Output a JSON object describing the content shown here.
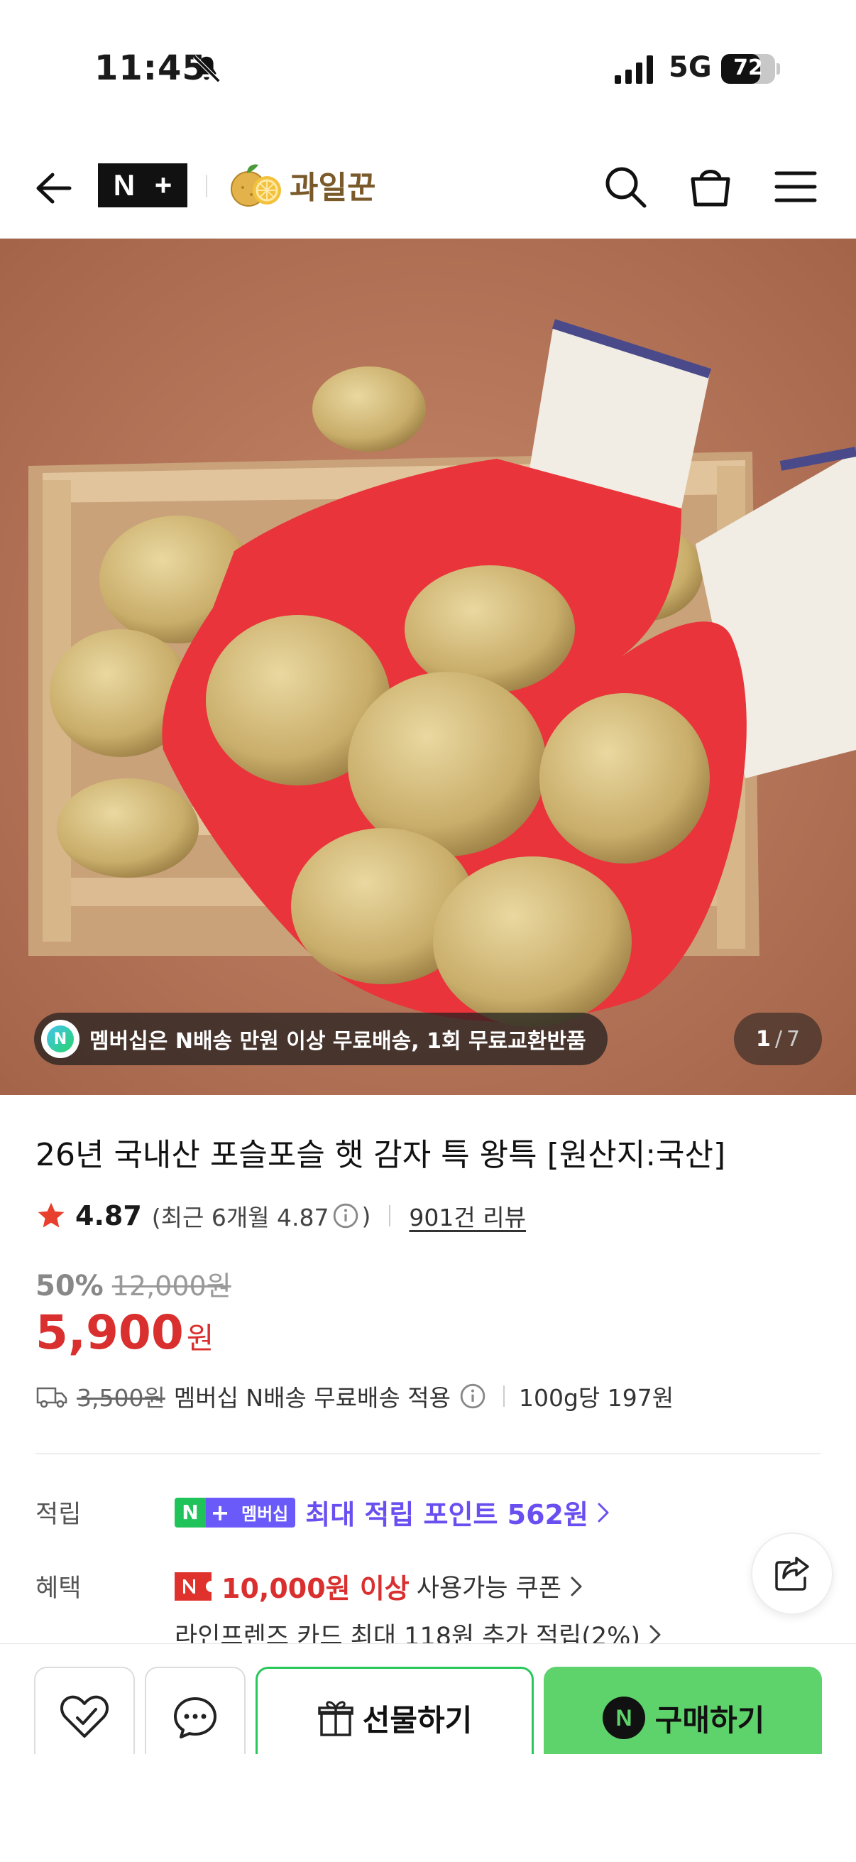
{
  "status_bar": {
    "time": "11:45",
    "network": "5G",
    "battery_level": "72",
    "battery_fraction": 0.72
  },
  "header": {
    "nplus_logo": [
      "N",
      "+"
    ],
    "store_name": "과일꾼"
  },
  "hero": {
    "banner_icon_letter": "N",
    "banner_text": "멤버십은 N배송 만원 이상 무료배송, 1회 무료교환반품",
    "page_current": "1",
    "page_separator": "/",
    "page_total": "7"
  },
  "product": {
    "title": "26년 국내산 포슬포슬 햇 감자 특 왕특 [원산지:국산]",
    "rating": "4.87",
    "rating_recent_prefix": "(최근 6개월 4.87",
    "rating_recent_suffix": ")",
    "review_count": "901건 리뷰",
    "discount_rate": "50%",
    "original_price": "12,000원",
    "price": "5,900",
    "price_unit": "원",
    "shipping_fee": "3,500원",
    "shipping_text": "멤버십 N배송 무료배송 적용",
    "unit_price": "100g당 197원"
  },
  "benefits": {
    "points_label": "적립",
    "member_badge": {
      "n": "N",
      "plus": "+",
      "text": "멤버십"
    },
    "points_text": "최대 적립 포인트 562원",
    "benefit_label": "혜택",
    "coupon_amount": "10,000원 이상",
    "coupon_text": "사용가능 쿠폰",
    "card_text": "라인프렌즈 카드 최대 118원 추가 적립(2%)"
  },
  "bottom_bar": {
    "gift_label": "선물하기",
    "buy_label": "구매하기",
    "buy_icon_letter": "N"
  },
  "colors": {
    "price_red": "#d92f2f",
    "points_purple": "#6a4ff0",
    "buy_green": "#5ed36b",
    "gift_border": "#29c85a"
  }
}
